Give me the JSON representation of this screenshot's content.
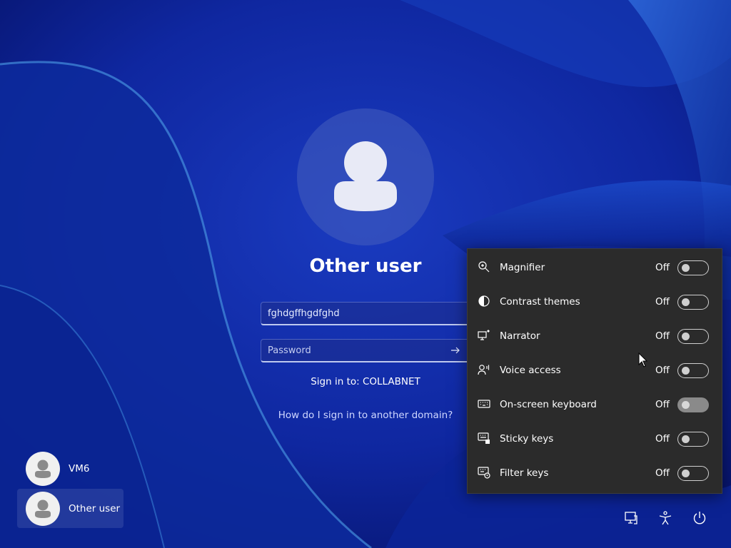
{
  "login": {
    "user_title": "Other user",
    "username_value": "fghdgffhgdfghd",
    "password_placeholder": "Password",
    "sign_in_to": "Sign in to: COLLABNET",
    "other_domain_link": "How do I sign in to another domain?"
  },
  "users": [
    {
      "name": "VM6"
    },
    {
      "name": "Other user"
    }
  ],
  "accessibility": {
    "items": [
      {
        "label": "Magnifier",
        "state": "Off",
        "icon": "magnifier-icon"
      },
      {
        "label": "Contrast themes",
        "state": "Off",
        "icon": "contrast-icon"
      },
      {
        "label": "Narrator",
        "state": "Off",
        "icon": "narrator-icon"
      },
      {
        "label": "Voice access",
        "state": "Off",
        "icon": "voice-access-icon"
      },
      {
        "label": "On-screen keyboard",
        "state": "Off",
        "icon": "keyboard-icon"
      },
      {
        "label": "Sticky keys",
        "state": "Off",
        "icon": "sticky-keys-icon"
      },
      {
        "label": "Filter keys",
        "state": "Off",
        "icon": "filter-keys-icon"
      }
    ]
  },
  "tray": {
    "icons": [
      "network-icon",
      "accessibility-icon",
      "power-icon"
    ]
  },
  "colors": {
    "background": "#0c1f8f",
    "panel": "#2b2b2b"
  }
}
